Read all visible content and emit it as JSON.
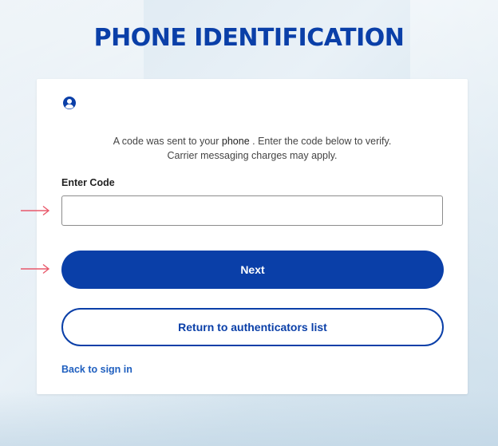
{
  "page": {
    "title": "PHONE IDENTIFICATION"
  },
  "card": {
    "icon": "user-circle-icon",
    "message_prefix": "A code was sent to your ",
    "message_phone": "phone",
    "message_suffix": " .  Enter the code below to verify.",
    "message_line2": "Carrier messaging charges may apply.",
    "code_label": "Enter Code",
    "code_value": "",
    "next_label": "Next",
    "return_label": "Return to authenticators list",
    "back_link": "Back to sign in"
  },
  "annotations": {
    "arrow_color": "#e8596b"
  },
  "colors": {
    "brand": "#0a3fa8",
    "link": "#1f5fbf"
  }
}
